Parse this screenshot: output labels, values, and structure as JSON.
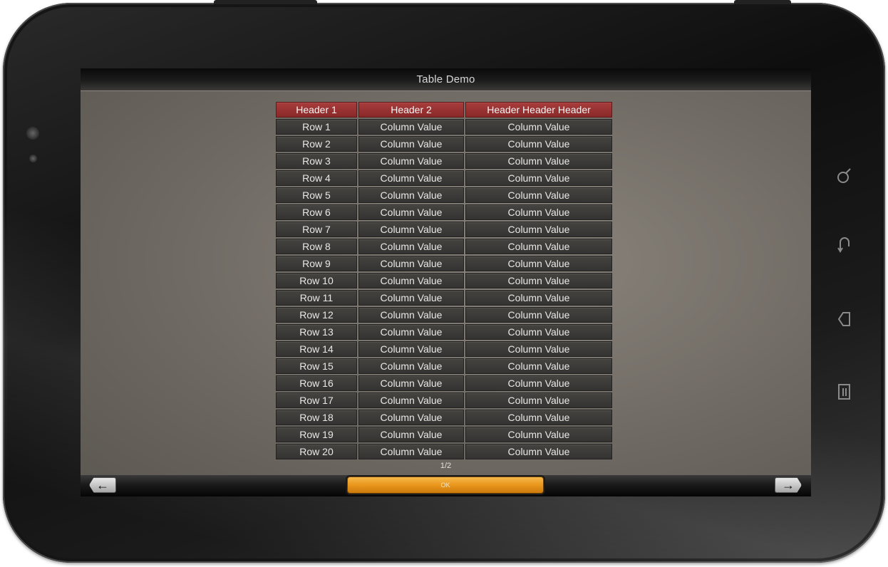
{
  "window": {
    "title": "Table Demo"
  },
  "table": {
    "headers": [
      "Header 1",
      "Header 2",
      "Header Header Header"
    ],
    "rows": [
      [
        "Row 1",
        "Column Value",
        "Column Value"
      ],
      [
        "Row 2",
        "Column Value",
        "Column Value"
      ],
      [
        "Row 3",
        "Column Value",
        "Column Value"
      ],
      [
        "Row 4",
        "Column Value",
        "Column Value"
      ],
      [
        "Row 5",
        "Column Value",
        "Column Value"
      ],
      [
        "Row 6",
        "Column Value",
        "Column Value"
      ],
      [
        "Row 7",
        "Column Value",
        "Column Value"
      ],
      [
        "Row 8",
        "Column Value",
        "Column Value"
      ],
      [
        "Row 9",
        "Column Value",
        "Column Value"
      ],
      [
        "Row 10",
        "Column Value",
        "Column Value"
      ],
      [
        "Row 11",
        "Column Value",
        "Column Value"
      ],
      [
        "Row 12",
        "Column Value",
        "Column Value"
      ],
      [
        "Row 13",
        "Column Value",
        "Column Value"
      ],
      [
        "Row 14",
        "Column Value",
        "Column Value"
      ],
      [
        "Row 15",
        "Column Value",
        "Column Value"
      ],
      [
        "Row 16",
        "Column Value",
        "Column Value"
      ],
      [
        "Row 17",
        "Column Value",
        "Column Value"
      ],
      [
        "Row 18",
        "Column Value",
        "Column Value"
      ],
      [
        "Row 19",
        "Column Value",
        "Column Value"
      ],
      [
        "Row 20",
        "Column Value",
        "Column Value"
      ]
    ]
  },
  "pager": {
    "text": "1/2"
  },
  "footer": {
    "ok_label": "OK",
    "prev_icon": "arrow-left-icon",
    "next_icon": "arrow-right-icon"
  },
  "hardware_keys": [
    "search-icon",
    "back-icon",
    "home-icon",
    "menu-icon"
  ],
  "colors": {
    "header_cell": "#9a3232",
    "ok_button": "#e9961c",
    "cell_bg": "#3d3b38"
  }
}
